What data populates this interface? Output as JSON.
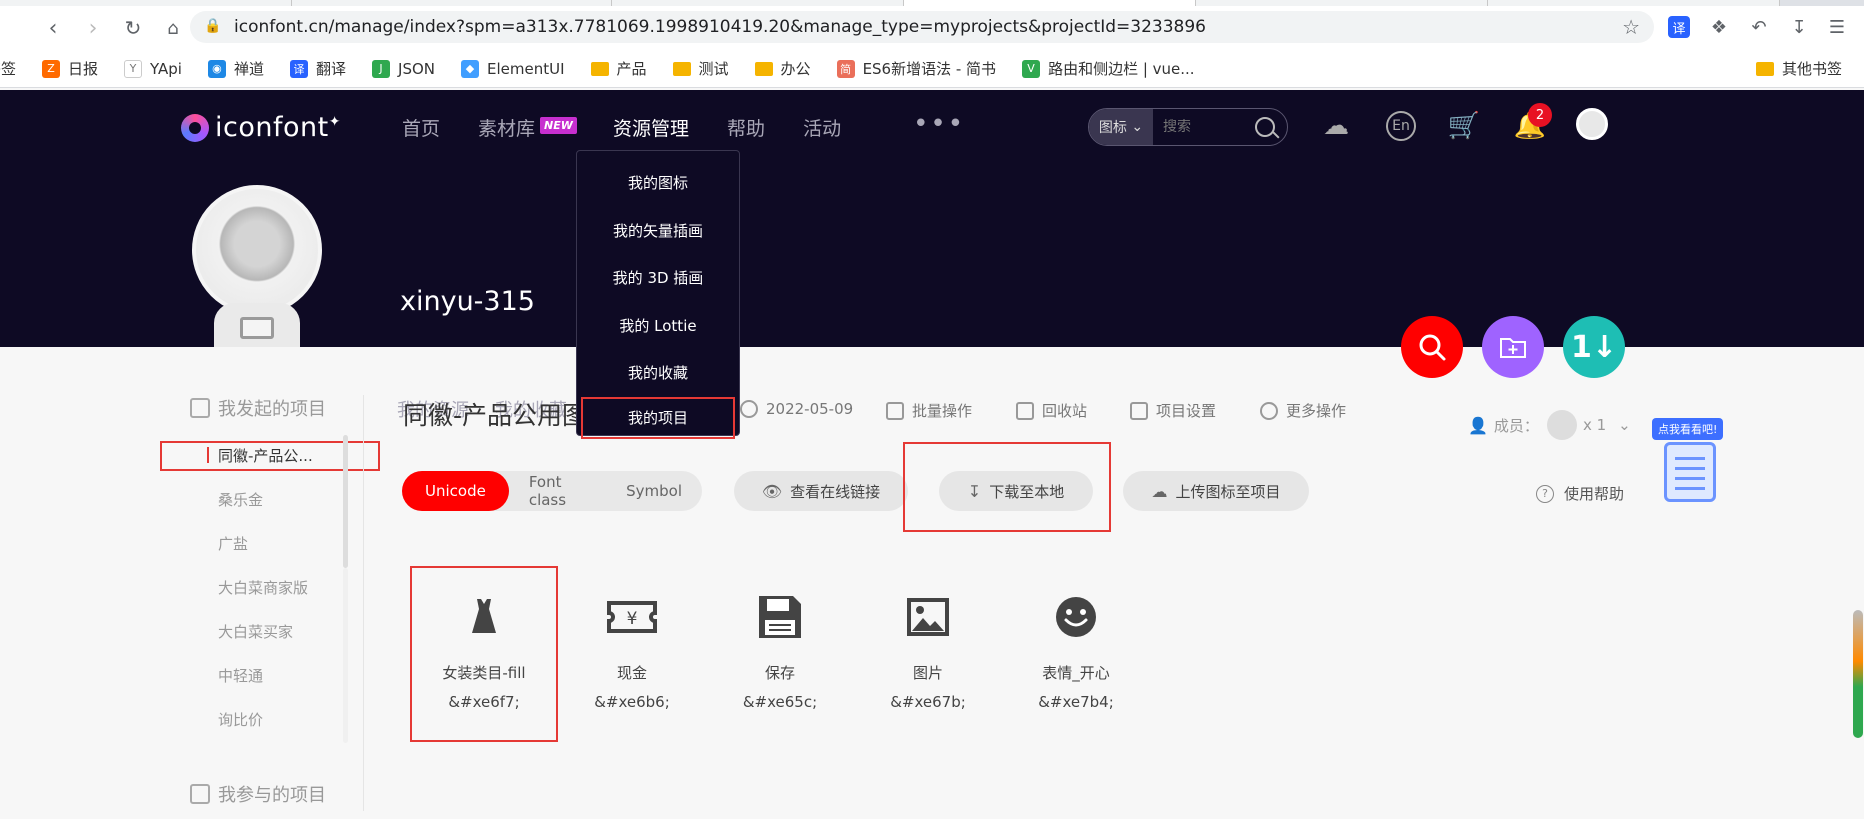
{
  "browser": {
    "url": "iconfont.cn/manage/index?spm=a313x.7781069.1998910419.20&manage_type=myprojects&projectId=3233896",
    "bookmarks": [
      {
        "label": "书签",
        "icon": "bookmark-icon",
        "color": "#ffffff"
      },
      {
        "label": "日报",
        "icon": "daily-icon",
        "color": "#ff6a00"
      },
      {
        "label": "YApi",
        "icon": "yapi-icon",
        "color": "#ffffff"
      },
      {
        "label": "禅道",
        "icon": "zentao-icon",
        "color": "#1e88e5"
      },
      {
        "label": "翻译",
        "icon": "translate-icon",
        "color": "#2962ff"
      },
      {
        "label": "JSON",
        "icon": "json-icon",
        "color": "#2fa84f"
      },
      {
        "label": "ElementUI",
        "icon": "element-icon",
        "color": "#409eff"
      },
      {
        "label": "产品",
        "icon": "folder-icon",
        "color": "#f5b400"
      },
      {
        "label": "测试",
        "icon": "folder-icon",
        "color": "#f5b400"
      },
      {
        "label": "办公",
        "icon": "folder-icon",
        "color": "#f5b400"
      },
      {
        "label": "ES6新增语法 - 简书",
        "icon": "jianshu-icon",
        "color": "#ea6f5a"
      },
      {
        "label": "路由和侧边栏 | vue...",
        "icon": "vue-icon",
        "color": "#2fa84f"
      }
    ],
    "other_bookmarks": "其他书签"
  },
  "header": {
    "logo": "iconfont",
    "nav": [
      "首页",
      "素材库",
      "资源管理",
      "帮助",
      "活动"
    ],
    "new_badge": "NEW",
    "search_select": "图标",
    "search_placeholder": "搜索",
    "notification_count": "2",
    "username": "xinyu-315",
    "profile_tabs": [
      "我的资源",
      "我的收藏"
    ]
  },
  "dropdown": [
    "我的图标",
    "我的矢量插画",
    "我的 3D 插画",
    "我的 Lottie",
    "我的收藏",
    "我的项目"
  ],
  "sidebar": {
    "my_projects_title": "我发起的项目",
    "projects": [
      "同徽-产品公...",
      "桑乐金",
      "广盐",
      "大白菜商家版",
      "大白菜买家",
      "中轻通",
      "询比价"
    ],
    "joined_title": "我参与的项目"
  },
  "project": {
    "title": "同徽-产品公用图",
    "date": "2022-05-09",
    "actions": [
      "批量操作",
      "回收站",
      "项目设置",
      "更多操作"
    ],
    "members_label": "成员：",
    "members_count": "x 1",
    "tabs": [
      "Unicode",
      "Font class",
      "Symbol"
    ],
    "buttons": [
      "查看在线链接",
      "下载至本地",
      "上传图标至项目"
    ],
    "help": "使用帮助",
    "mascot_text": "点我看看吧!"
  },
  "icons": [
    {
      "name": "女装类目-fill",
      "code": "&#xe6f7;",
      "icon": "dress-icon"
    },
    {
      "name": "现金",
      "code": "&#xe6b6;",
      "icon": "cash-icon"
    },
    {
      "name": "保存",
      "code": "&#xe65c;",
      "icon": "save-icon"
    },
    {
      "name": "图片",
      "code": "&#xe67b;",
      "icon": "image-icon"
    },
    {
      "name": "表情_开心",
      "code": "&#xe7b4;",
      "icon": "smile-icon"
    }
  ],
  "colors": {
    "header_bg": "#0e0a24",
    "accent_red": "#ff0000",
    "fab_purple": "#9f63ff",
    "fab_teal": "#1ebeb4"
  }
}
